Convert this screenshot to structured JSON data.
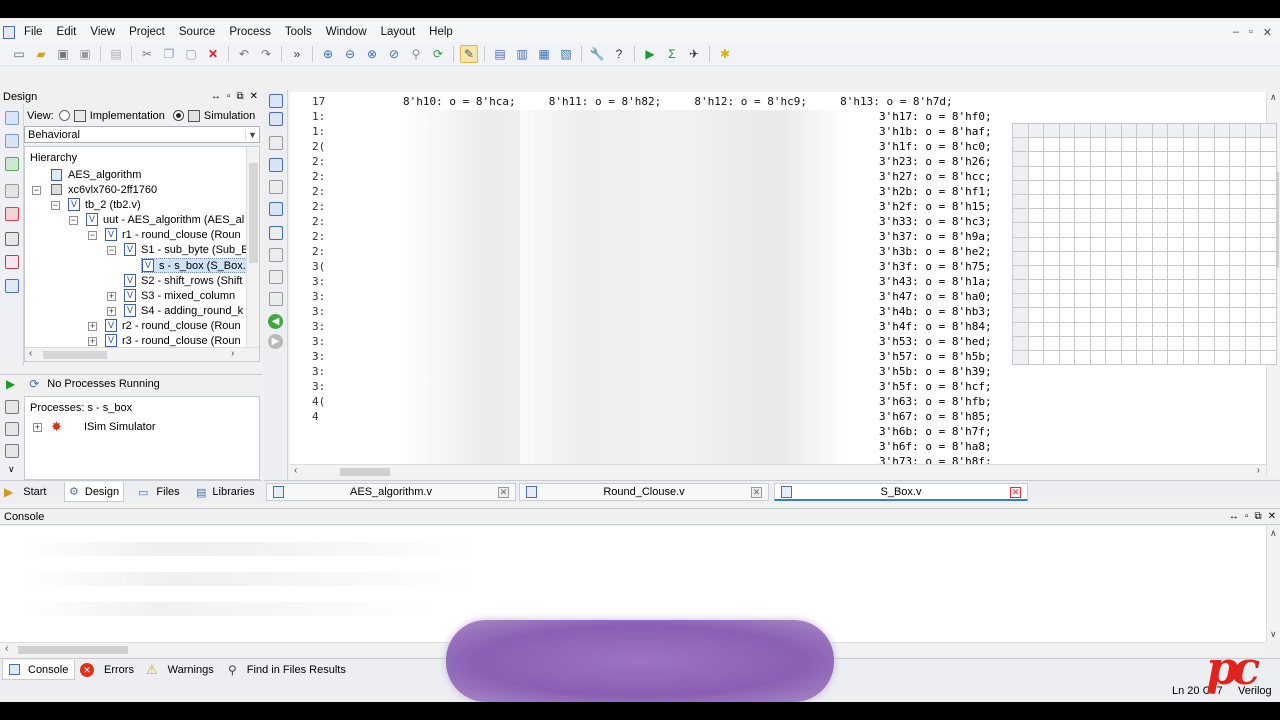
{
  "menu": [
    "File",
    "Edit",
    "View",
    "Project",
    "Source",
    "Process",
    "Tools",
    "Window",
    "Layout",
    "Help"
  ],
  "design_panel": {
    "title": "Design",
    "view_label": "View:",
    "view_options": [
      "Implementation",
      "Simulation"
    ],
    "view_selected": "Simulation",
    "filter_value": "Behavioral",
    "hierarchy_title": "Hierarchy",
    "tree": [
      "AES_algorithm",
      "xc6vlx760-2ff1760",
      "tb_2 (tb2.v)",
      "uut - AES_algorithm (AES_al",
      "r1 - round_clouse (Roun",
      "S1 - sub_byte (Sub_E",
      "s - s_box (S_Box.",
      "S2 - shift_rows (Shift",
      "S3 - mixed_column",
      "S4 - adding_round_k",
      "r2 - round_clouse (Roun",
      "r3 - round_clouse (Roun"
    ]
  },
  "process_panel": {
    "status": "No Processes Running",
    "processes_label": "Processes: s - s_box",
    "items": [
      "ISim Simulator"
    ]
  },
  "left_tabs": [
    "Start",
    "Design",
    "Files",
    "Libraries"
  ],
  "editor": {
    "first_line": {
      "num": "17",
      "code": "8'h10: o = 8'hca;     8'h11: o = 8'h82;     8'h12: o = 8'hc9;     8'h13: o = 8'h7d;"
    },
    "line_prefixes": [
      "1:",
      "1:",
      "2(",
      "2:",
      "2:",
      "2:",
      "2:",
      "2:",
      "2:",
      "2:",
      "3(",
      "3:",
      "3:",
      "3:",
      "3:",
      "3:",
      "3:",
      "3:",
      "3:",
      "4(",
      "4"
    ],
    "right_lines": [
      "3'h17: o = 8'hf0;",
      "3'h1b: o = 8'haf;",
      "3'h1f: o = 8'hc0;",
      "3'h23: o = 8'h26;",
      "3'h27: o = 8'hcc;",
      "3'h2b: o = 8'hf1;",
      "3'h2f: o = 8'h15;",
      "3'h33: o = 8'hc3;",
      "3'h37: o = 8'h9a;",
      "3'h3b: o = 8'he2;",
      "3'h3f: o = 8'h75;",
      "3'h43: o = 8'h1a;",
      "3'h47: o = 8'ha0;",
      "3'h4b: o = 8'hb3;",
      "3'h4f: o = 8'h84;",
      "3'h53: o = 8'hed;",
      "3'h57: o = 8'h5b;",
      "3'h5b: o = 8'h39;",
      "3'h5f: o = 8'hcf;",
      "3'h63: o = 8'hfb;",
      "3'h67: o = 8'h85;",
      "3'h6b: o = 8'h7f;",
      "3'h6f: o = 8'ha8;",
      "3'h73: o = 8'h8f;"
    ]
  },
  "editor_tabs": [
    "AES_algorithm.v",
    "Round_Clouse.v",
    "S_Box.v"
  ],
  "console": {
    "title": "Console"
  },
  "bottom_tabs": [
    "Console",
    "Errors",
    "Warnings",
    "Find in Files Results"
  ],
  "status_bar": {
    "position": "Ln 20 C",
    "col": "77",
    "lang": "Verilog"
  },
  "colors": {
    "accent": "#2a4e9a",
    "overlay_purple": "#8e63b5",
    "watermark_red": "#e0231c"
  }
}
